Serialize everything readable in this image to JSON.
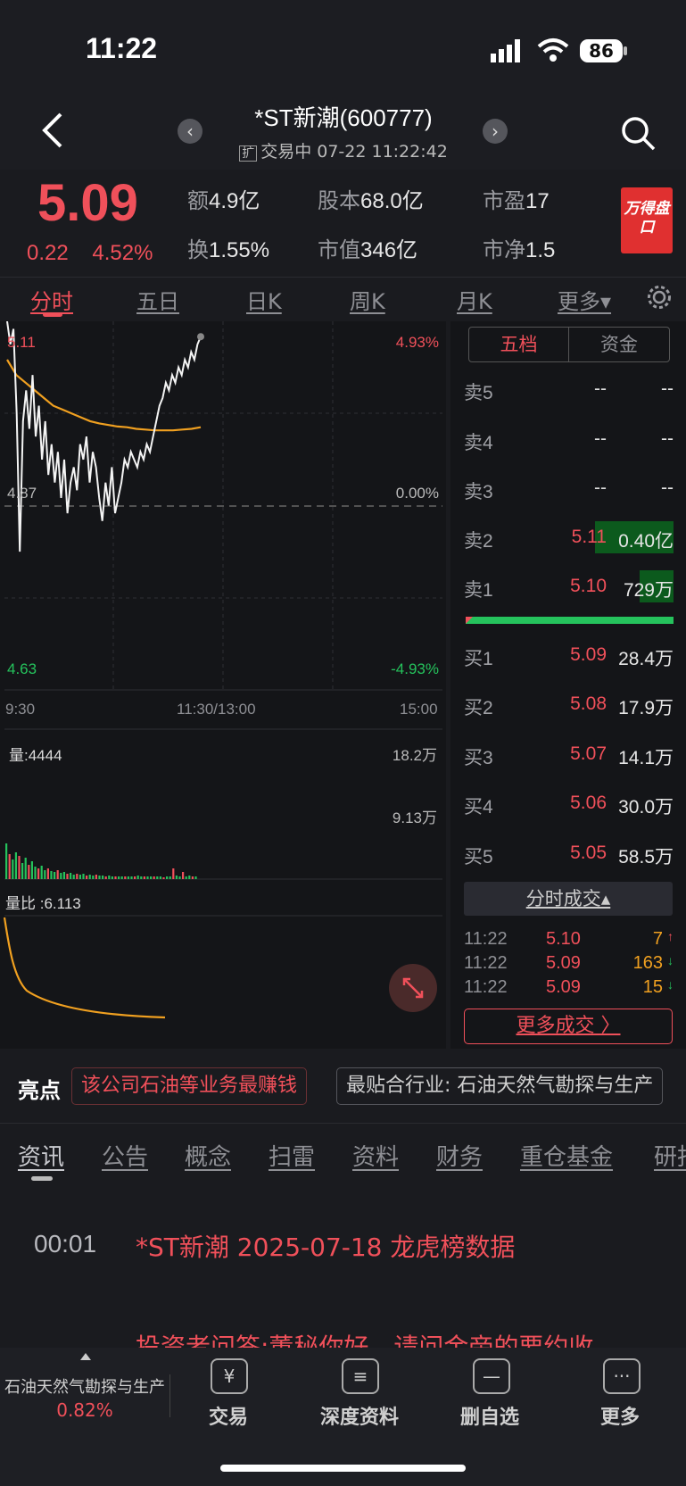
{
  "status": {
    "time": "11:22",
    "battery": "86"
  },
  "header": {
    "title": "*ST新潮(600777)",
    "badge": "扩",
    "subtitle": "交易中 07-22 11:22:42"
  },
  "quote": {
    "price": "5.09",
    "change": "0.22",
    "change_pct": "4.52%",
    "stats": [
      {
        "k": "额",
        "v": "4.9亿"
      },
      {
        "k": "股本",
        "v": "68.0亿"
      },
      {
        "k": "市盈",
        "v": "17"
      },
      {
        "k": "换",
        "v": "1.55%"
      },
      {
        "k": "市值",
        "v": "346亿"
      },
      {
        "k": "市净",
        "v": "1.5"
      }
    ],
    "wande_label": "万得盘口"
  },
  "tabs": [
    "分时",
    "五日",
    "日K",
    "周K",
    "月K",
    "更多▾"
  ],
  "chart": {
    "y_top_label": "5.11",
    "y_mid_label": "4.87",
    "y_bottom_label": "4.63",
    "pct_top": "4.93%",
    "pct_mid": "0.00%",
    "pct_bottom": "-4.93%",
    "x_labels": [
      "9:30",
      "11:30/13:00",
      "15:00"
    ],
    "volume_label": "量:4444",
    "vol_max": "18.2万",
    "vol_mid": "9.13万",
    "ratio_label": "量比  :6.113",
    "price_series": [
      5.11,
      5.08,
      5.1,
      4.99,
      4.81,
      4.98,
      5.02,
      4.97,
      5.04,
      4.96,
      5.0,
      4.93,
      4.98,
      4.91,
      4.95,
      4.9,
      4.94,
      4.88,
      4.93,
      4.86,
      4.9,
      4.92,
      4.89,
      4.95,
      4.93,
      4.96,
      4.9,
      4.94,
      4.92,
      4.88,
      4.85,
      4.9,
      4.87,
      4.92,
      4.86,
      4.88,
      4.9,
      4.93,
      4.92,
      4.94,
      4.93,
      4.92,
      4.94,
      4.93,
      4.95,
      4.94,
      4.96,
      4.98,
      5.0,
      5.01,
      5.03,
      5.02,
      5.04,
      5.03,
      5.05,
      5.04,
      5.06,
      5.05,
      5.07,
      5.06,
      5.08,
      5.09
    ],
    "avg_series": [
      5.06,
      5.04,
      5.03,
      5.02,
      5.01,
      5.0,
      4.995,
      4.99,
      4.985,
      4.98,
      4.977,
      4.975,
      4.973,
      4.972,
      4.97,
      4.969,
      4.968,
      4.968,
      4.968,
      4.969,
      4.97,
      4.972
    ]
  },
  "panel": {
    "seg_labels": [
      "五档",
      "资金"
    ],
    "asks": [
      {
        "label": "卖5",
        "price": "--",
        "vol": "--"
      },
      {
        "label": "卖4",
        "price": "--",
        "vol": "--"
      },
      {
        "label": "卖3",
        "price": "--",
        "vol": "--"
      },
      {
        "label": "卖2",
        "price": "5.11",
        "vol": "0.40亿"
      },
      {
        "label": "卖1",
        "price": "5.10",
        "vol": "729万"
      }
    ],
    "bids": [
      {
        "label": "买1",
        "price": "5.09",
        "vol": "28.4万"
      },
      {
        "label": "买2",
        "price": "5.08",
        "vol": "17.9万"
      },
      {
        "label": "买3",
        "price": "5.07",
        "vol": "14.1万"
      },
      {
        "label": "买4",
        "price": "5.06",
        "vol": "30.0万"
      },
      {
        "label": "买5",
        "price": "5.05",
        "vol": "58.5万"
      }
    ],
    "trades_header": "分时成交▴",
    "trades": [
      {
        "t": "11:22",
        "p": "5.10",
        "v": "7",
        "dir": "↑"
      },
      {
        "t": "11:22",
        "p": "5.09",
        "v": "163",
        "dir": "↓"
      },
      {
        "t": "11:22",
        "p": "5.09",
        "v": "15",
        "dir": "↓"
      }
    ],
    "more_trades": "更多成交  〉"
  },
  "highlights": {
    "label": "亮点",
    "chip1": "该公司石油等业务最赚钱",
    "chip2": "最贴合行业: 石油天然气勘探与生产"
  },
  "news_tabs": [
    "资讯",
    "公告",
    "概念",
    "扫雷",
    "资料",
    "财务",
    "重仓基金",
    "研报"
  ],
  "news": [
    {
      "time": "00:01",
      "title": "*ST新潮 2025-07-18 龙虎榜数据"
    },
    {
      "time": "",
      "title": "投资者问答:董秘你好，请问金帝的要约收"
    }
  ],
  "bottom": {
    "industry": "石油天然气勘探与生产",
    "industry_pct": "0.82%",
    "items": [
      {
        "icon": "¥",
        "label": "交易"
      },
      {
        "icon": "≡",
        "label": "深度资料"
      },
      {
        "icon": "—",
        "label": "删自选"
      },
      {
        "icon": "···",
        "label": "更多"
      }
    ]
  },
  "colors": {
    "up": "#f0505a",
    "down": "#25c25c",
    "avg": "#f0a020"
  }
}
